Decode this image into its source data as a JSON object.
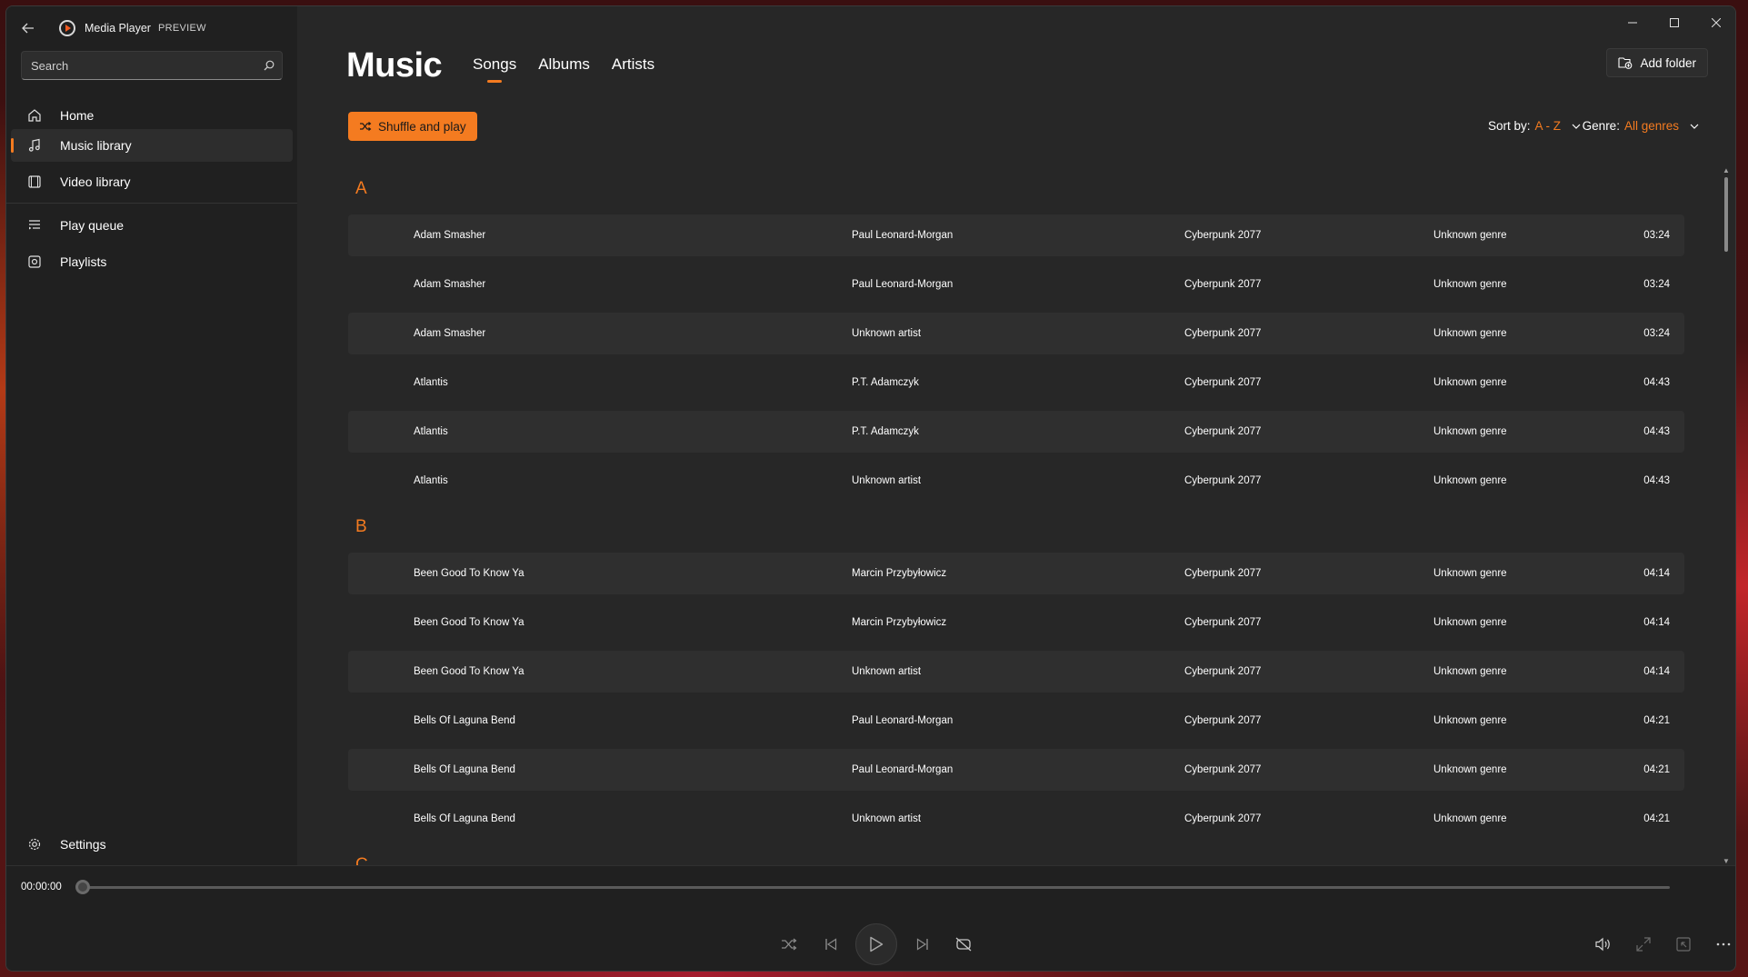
{
  "app": {
    "title": "Media Player",
    "badge": "PREVIEW"
  },
  "search": {
    "placeholder": "Search"
  },
  "nav": {
    "home": "Home",
    "music_library": "Music library",
    "video_library": "Video library",
    "play_queue": "Play queue",
    "playlists": "Playlists",
    "settings": "Settings"
  },
  "header": {
    "title": "Music",
    "tabs": [
      "Songs",
      "Albums",
      "Artists"
    ],
    "add_folder": "Add folder",
    "shuffle": "Shuffle and play",
    "sort_label": "Sort by:",
    "sort_value": "A - Z",
    "genre_label": "Genre:",
    "genre_value": "All genres"
  },
  "groups": [
    {
      "letter": "A",
      "songs": [
        {
          "title": "Adam Smasher",
          "artist": "Paul Leonard-Morgan",
          "album": "Cyberpunk 2077",
          "genre": "Unknown genre",
          "duration": "03:24"
        },
        {
          "title": "Adam Smasher",
          "artist": "Paul Leonard-Morgan",
          "album": "Cyberpunk 2077",
          "genre": "Unknown genre",
          "duration": "03:24"
        },
        {
          "title": "Adam Smasher",
          "artist": "Unknown artist",
          "album": "Cyberpunk 2077",
          "genre": "Unknown genre",
          "duration": "03:24"
        },
        {
          "title": "Atlantis",
          "artist": "P.T. Adamczyk",
          "album": "Cyberpunk 2077",
          "genre": "Unknown genre",
          "duration": "04:43"
        },
        {
          "title": "Atlantis",
          "artist": "P.T. Adamczyk",
          "album": "Cyberpunk 2077",
          "genre": "Unknown genre",
          "duration": "04:43"
        },
        {
          "title": "Atlantis",
          "artist": "Unknown artist",
          "album": "Cyberpunk 2077",
          "genre": "Unknown genre",
          "duration": "04:43"
        }
      ]
    },
    {
      "letter": "B",
      "songs": [
        {
          "title": "Been Good To Know Ya",
          "artist": "Marcin Przybyłowicz",
          "album": "Cyberpunk 2077",
          "genre": "Unknown genre",
          "duration": "04:14"
        },
        {
          "title": "Been Good To Know Ya",
          "artist": "Marcin Przybyłowicz",
          "album": "Cyberpunk 2077",
          "genre": "Unknown genre",
          "duration": "04:14"
        },
        {
          "title": "Been Good To Know Ya",
          "artist": "Unknown artist",
          "album": "Cyberpunk 2077",
          "genre": "Unknown genre",
          "duration": "04:14"
        },
        {
          "title": "Bells Of Laguna Bend",
          "artist": "Paul Leonard-Morgan",
          "album": "Cyberpunk 2077",
          "genre": "Unknown genre",
          "duration": "04:21"
        },
        {
          "title": "Bells Of Laguna Bend",
          "artist": "Paul Leonard-Morgan",
          "album": "Cyberpunk 2077",
          "genre": "Unknown genre",
          "duration": "04:21"
        },
        {
          "title": "Bells Of Laguna Bend",
          "artist": "Unknown artist",
          "album": "Cyberpunk 2077",
          "genre": "Unknown genre",
          "duration": "04:21"
        }
      ]
    },
    {
      "letter": "C",
      "songs": []
    }
  ],
  "player": {
    "current_time": "00:00:00",
    "progress": 0
  },
  "colors": {
    "accent": "#f47b20",
    "window_bg": "#202020",
    "content_bg": "#272727",
    "row_alt_bg": "#2f2f2f"
  }
}
